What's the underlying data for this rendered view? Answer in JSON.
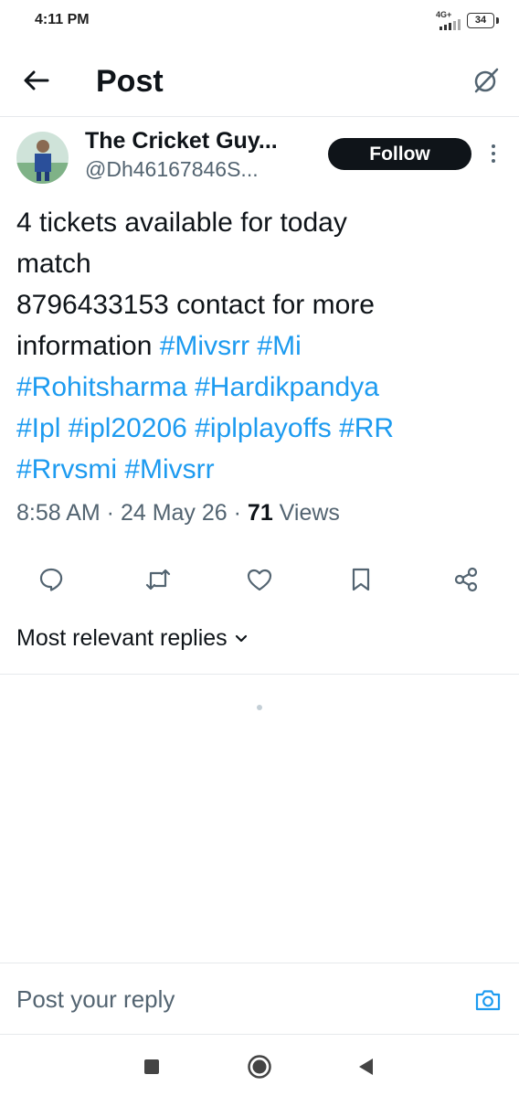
{
  "status_bar": {
    "time": "4:11 PM",
    "network": "4G+",
    "battery": "34",
    "signal_icon": "signal-bars-icon",
    "battery_icon": "battery-icon"
  },
  "header": {
    "title": "Post",
    "back_icon": "arrow-left-icon",
    "grok_icon": "grok-icon"
  },
  "post": {
    "author": {
      "name": "The Cricket Guy...",
      "handle": "@Dh46167846S..."
    },
    "follow_label": "Follow",
    "more_icon": "more-vertical-icon",
    "text": {
      "line1": "4 tickets available for today",
      "line2": "match",
      "line3": "8796433153 contact for more",
      "line4_prefix": "information ",
      "hashtags": [
        "#Mivsrr",
        "#Mi",
        "#Rohitsharma",
        "#Hardikpandya",
        "#Ipl",
        "#ipl20206",
        "#iplplayoffs",
        "#RR",
        "#Rrvsmi",
        "#Mivsrr"
      ]
    },
    "meta": {
      "time": "8:58 AM",
      "separator": " · ",
      "date": "24 May 26",
      "views_count": "71",
      "views_label": " Views"
    },
    "actions": [
      "reply-icon",
      "repost-icon",
      "like-icon",
      "bookmark-icon",
      "share-icon"
    ]
  },
  "replies": {
    "sort_label": "Most relevant replies",
    "sort_icon": "chevron-down-icon"
  },
  "composer": {
    "placeholder": "Post your reply",
    "camera_icon": "camera-icon"
  },
  "nav": [
    "recents-icon",
    "home-icon",
    "back-triangle-icon"
  ],
  "colors": {
    "text": "#0f1419",
    "secondary": "#536471",
    "link": "#1d9bf0",
    "follow_bg": "#0f1419",
    "divider": "#e6e9ec"
  }
}
